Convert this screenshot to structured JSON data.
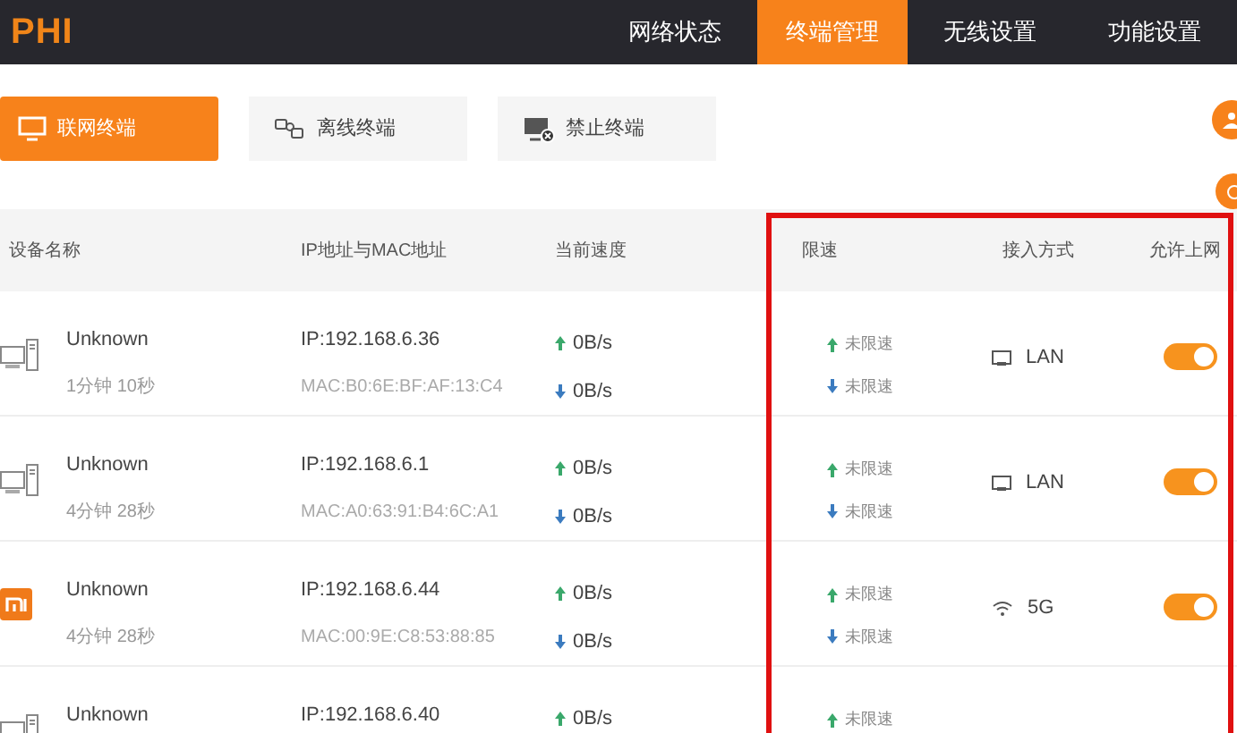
{
  "logo": "PHI",
  "nav": [
    {
      "label": "网络状态",
      "selected": false
    },
    {
      "label": "终端管理",
      "selected": true
    },
    {
      "label": "无线设置",
      "selected": false
    },
    {
      "label": "功能设置",
      "selected": false
    }
  ],
  "tabs": [
    {
      "label": "联网终端",
      "selected": true,
      "kind": "online"
    },
    {
      "label": "离线终端",
      "selected": false,
      "kind": "offline"
    },
    {
      "label": "禁止终端",
      "selected": false,
      "kind": "blocked"
    }
  ],
  "table": {
    "columns": [
      "设备名称",
      "IP地址与MAC地址",
      "当前速度",
      "限速",
      "接入方式",
      "允许上网"
    ],
    "rows": [
      {
        "kind": "computer",
        "name": "Unknown",
        "duration": "1分钟 10秒",
        "ip": "IP:192.168.6.36",
        "mac": "MAC:B0:6E:BF:AF:13:C4",
        "up": "0B/s",
        "down": "0B/s",
        "limit_up": "未限速",
        "limit_down": "未限速",
        "access": {
          "kind": "lan",
          "label": "LAN"
        },
        "allow": {
          "kind": "toggle",
          "on": true
        }
      },
      {
        "kind": "computer",
        "name": "Unknown",
        "duration": "4分钟 28秒",
        "ip": "IP:192.168.6.1",
        "mac": "MAC:A0:63:91:B4:6C:A1",
        "up": "0B/s",
        "down": "0B/s",
        "limit_up": "未限速",
        "limit_down": "未限速",
        "access": {
          "kind": "lan",
          "label": "LAN"
        },
        "allow": {
          "kind": "toggle",
          "on": true
        }
      },
      {
        "kind": "phone",
        "name": "Unknown",
        "duration": "4分钟 28秒",
        "ip": "IP:192.168.6.44",
        "mac": "MAC:00:9E:C8:53:88:85",
        "up": "0B/s",
        "down": "0B/s",
        "limit_up": "未限速",
        "limit_down": "未限速",
        "access": {
          "kind": "wifi",
          "label": "5G"
        },
        "allow": {
          "kind": "toggle",
          "on": true
        }
      },
      {
        "kind": "computer",
        "name": "Unknown",
        "ip": "IP:192.168.6.40",
        "up": "0B/s",
        "limit_up": "未限速"
      }
    ]
  }
}
